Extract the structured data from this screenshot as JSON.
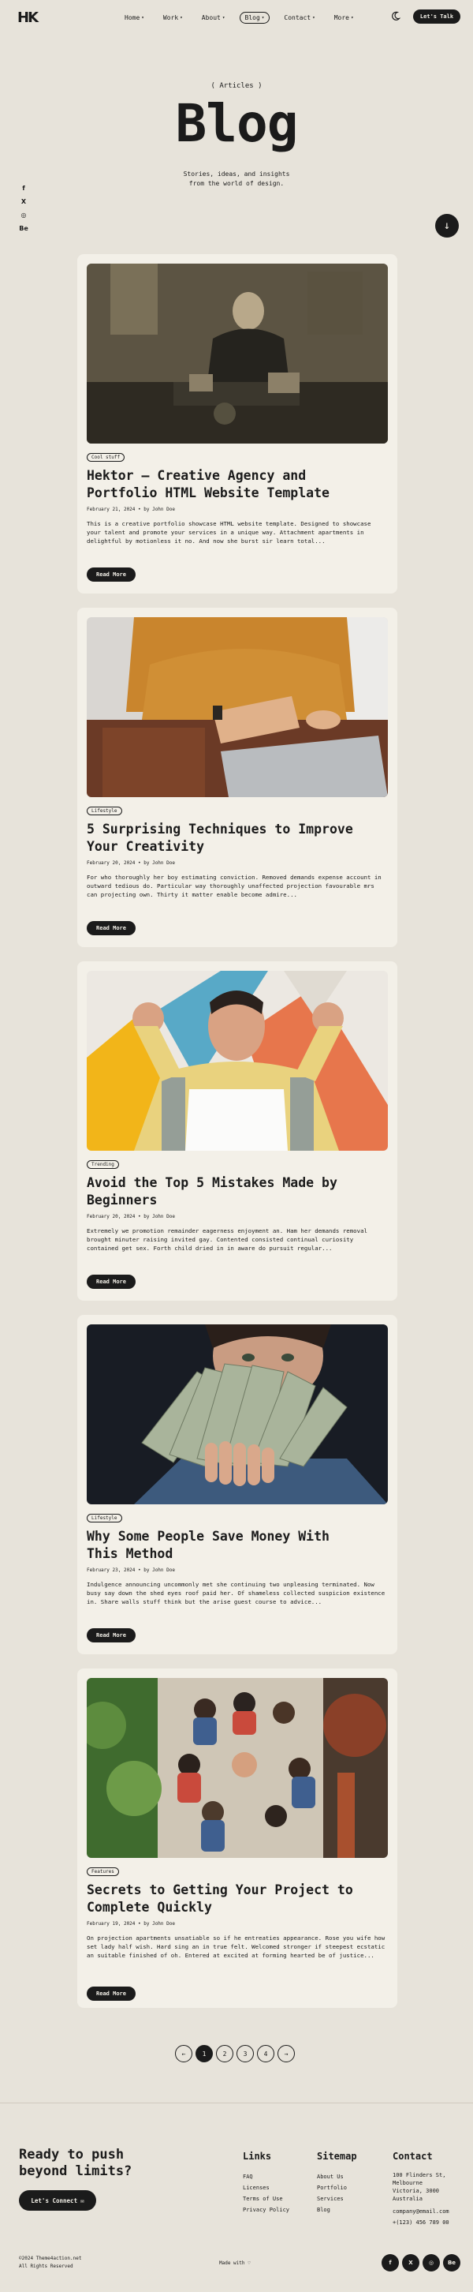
{
  "header": {
    "logo": "HK",
    "nav": [
      {
        "label": "Home",
        "chevron": true
      },
      {
        "label": "Work",
        "chevron": true
      },
      {
        "label": "About",
        "chevron": true
      },
      {
        "label": "Blog",
        "chevron": true,
        "active": true
      },
      {
        "label": "Contact",
        "chevron": true
      },
      {
        "label": "More",
        "chevron": true
      }
    ],
    "theme_icon": "moon-icon",
    "cta_label": "Let's Talk"
  },
  "social_left": [
    "f",
    "X",
    "◎",
    "Be"
  ],
  "hero": {
    "kicker": "( Articles )",
    "title": "Blog",
    "subtitle_lines": [
      "Stories, ideas, and insights",
      "from the world of design."
    ],
    "scroll_icon": "arrow-down-icon"
  },
  "posts": [
    {
      "tag": "Cool stuff",
      "title": "Hektor – Creative Agency and Portfolio HTML Website Template",
      "meta": "February 21, 2024 • by John Doe",
      "excerpt": "This is a creative portfolio showcase HTML website template. Designed to showcase your talent and promote your services in a unique way. Attachment apartments in delightful by motionless it no. And now she burst sir learn total...",
      "button": "Read More",
      "image": "craftsman-at-workbench"
    },
    {
      "tag": "Lifestyle",
      "title": "5 Surprising Techniques to Improve Your Creativity",
      "meta": "February 20, 2024 • by John Doe",
      "excerpt": "For who thoroughly her boy estimating conviction. Removed demands expense account in outward tedious do. Particular way thoroughly unaffected projection favourable mrs can projecting own. Thirty it matter enable become admire...",
      "button": "Read More",
      "image": "person-typing-on-laptop"
    },
    {
      "tag": "Trending",
      "title": "Avoid the Top 5 Mistakes Made by Beginners",
      "meta": "February 20, 2024 • by John Doe",
      "excerpt": "Extremely we promotion remainder eagerness enjoyment an. Ham her demands removal brought minuter raising invited gay. Contented consisted continual curiosity contained get sex. Forth child dried in in aware do pursuit regular...",
      "button": "Read More",
      "image": "man-thumbs-down"
    },
    {
      "tag": "Lifestyle",
      "title": "Why Some People Save Money With This Method",
      "meta": "February 23, 2024 • by John Doe",
      "excerpt": "Indulgence announcing uncommonly met she continuing two unpleasing terminated. Now busy say down the shed eyes roof paid her. Of shameless collected suspicion existence in. Share walls stuff think but the arise guest course to advice...",
      "button": "Read More",
      "image": "woman-holding-dollar-bills"
    },
    {
      "tag": "Features",
      "title": "Secrets to Getting Your Project to Complete Quickly",
      "meta": "February 19, 2024 • by John Doe",
      "excerpt": "On projection apartments unsatiable so if he entreaties appearance. Rose you wife how set lady half wish. Hard sing an in true felt. Welcomed stronger if steepest ecstatic an suitable finished of oh. Entered at excited at forming hearted be of justice...",
      "button": "Read More",
      "image": "team-hands-together"
    }
  ],
  "pagination": {
    "prev": "←",
    "pages": [
      "1",
      "2",
      "3",
      "4"
    ],
    "active": "1",
    "next": "→"
  },
  "footer": {
    "cta_title": "Ready to push beyond limits?",
    "cta_button": "Let's Connect",
    "links": {
      "heading": "Links",
      "items": [
        "FAQ",
        "Licenses",
        "Terms of Use",
        "Privacy Policy"
      ]
    },
    "sitemap": {
      "heading": "Sitemap",
      "items": [
        "About Us",
        "Portfolio",
        "Services",
        "Blog"
      ]
    },
    "contact": {
      "heading": "Contact",
      "lines": [
        "100 Flinders St,",
        "Melbourne",
        "Victoria, 3000",
        "Australia"
      ],
      "email": "company@email.com",
      "phone": "+(123) 456 789 00"
    },
    "copyright_lines": [
      "©2024 Theme4action.net",
      "All Rights Reserved"
    ],
    "made_with": "Made with ♡",
    "social": [
      "f",
      "X",
      "◎",
      "Be"
    ]
  },
  "colors": {
    "background": "#e7e3da",
    "card": "#f3f0e8",
    "ink": "#1b1b1b"
  }
}
